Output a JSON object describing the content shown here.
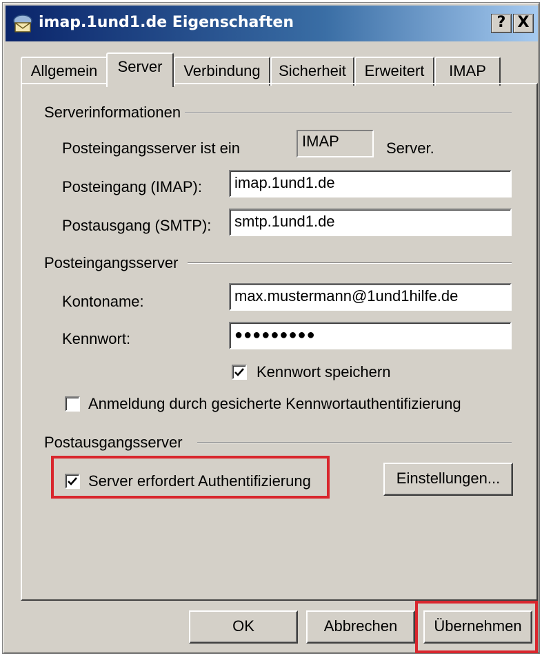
{
  "window": {
    "title": "imap.1und1.de Eigenschaften",
    "help_label": "?",
    "close_label": "X"
  },
  "tabs": [
    {
      "label": "Allgemein",
      "active": false
    },
    {
      "label": "Server",
      "active": true
    },
    {
      "label": "Verbindung",
      "active": false
    },
    {
      "label": "Sicherheit",
      "active": false
    },
    {
      "label": "Erweitert",
      "active": false
    },
    {
      "label": "IMAP",
      "active": false
    }
  ],
  "server_info": {
    "section_label": "Serverinformationen",
    "incoming_type_label": "Posteingangsserver ist ein",
    "incoming_type_value": "IMAP",
    "incoming_type_suffix": "Server.",
    "incoming_label": "Posteingang (IMAP):",
    "incoming_value": "imap.1und1.de",
    "outgoing_label": "Postausgang (SMTP):",
    "outgoing_value": "smtp.1und1.de"
  },
  "incoming_server": {
    "section_label": "Posteingangsserver",
    "account_label": "Kontoname:",
    "account_value": "max.mustermann@1und1hilfe.de",
    "password_label": "Kennwort:",
    "password_value": "●●●●●●●●●",
    "remember_password_label": "Kennwort speichern",
    "remember_password_checked": true,
    "spa_label": "Anmeldung durch gesicherte Kennwortauthentifizierung",
    "spa_checked": false
  },
  "outgoing_server": {
    "section_label": "Postausgangsserver",
    "auth_required_label": "Server erfordert Authentifizierung",
    "auth_required_checked": true,
    "settings_button_label": "Einstellungen..."
  },
  "footer": {
    "ok_label": "OK",
    "cancel_label": "Abbrechen",
    "apply_label": "Übernehmen"
  },
  "colors": {
    "highlight": "#d9262d",
    "title_bar_start": "#0a246a",
    "title_bar_end": "#a6caf0",
    "dialog_bg": "#d4d0c8"
  }
}
